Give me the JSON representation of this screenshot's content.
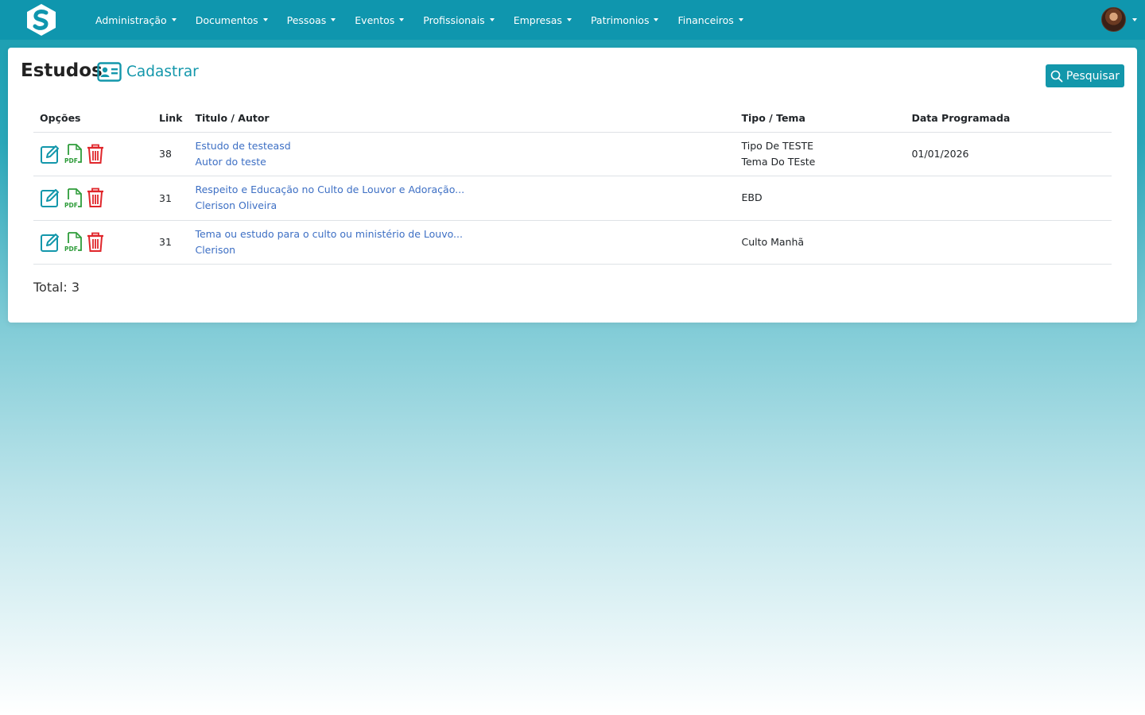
{
  "nav": {
    "brand_icon": "s-logo-icon",
    "items": [
      {
        "label": "Administração"
      },
      {
        "label": "Documentos"
      },
      {
        "label": "Pessoas"
      },
      {
        "label": "Eventos"
      },
      {
        "label": "Profissionais"
      },
      {
        "label": "Empresas"
      },
      {
        "label": "Patrimonios"
      },
      {
        "label": "Financeiros"
      }
    ],
    "avatar_icon": "user-avatar"
  },
  "page": {
    "title": "Estudos",
    "create_label": "Cadastrar",
    "search_label": "Pesquisar",
    "total_label": "Total: 3"
  },
  "table": {
    "headers": {
      "options": "Opções",
      "link": "Link",
      "title_author": "Titulo / Autor",
      "type_theme": "Tipo / Tema",
      "scheduled_date": "Data Programada"
    },
    "rows": [
      {
        "link": "38",
        "title": "Estudo de testeasd",
        "author": "Autor do teste",
        "type": "Tipo De TESTE",
        "theme": "Tema Do TEste",
        "date": "01/01/2026"
      },
      {
        "link": "31",
        "title": "Respeito e Educação no Culto de Louvor e Adoração...",
        "author": "Clerison Oliveira",
        "type": "EBD",
        "theme": "",
        "date": ""
      },
      {
        "link": "31",
        "title": "Tema ou estudo para o culto ou ministério de Louvo...",
        "author": "Clerison",
        "type": "Culto Manhã",
        "theme": "",
        "date": ""
      }
    ]
  },
  "colors": {
    "navbar": "#0f96ae",
    "accent": "#1397ab",
    "link": "#3d6fc4",
    "edit_icon": "#1397ab",
    "pdf_icon": "#2e9c3a",
    "delete_icon": "#e0262b"
  }
}
